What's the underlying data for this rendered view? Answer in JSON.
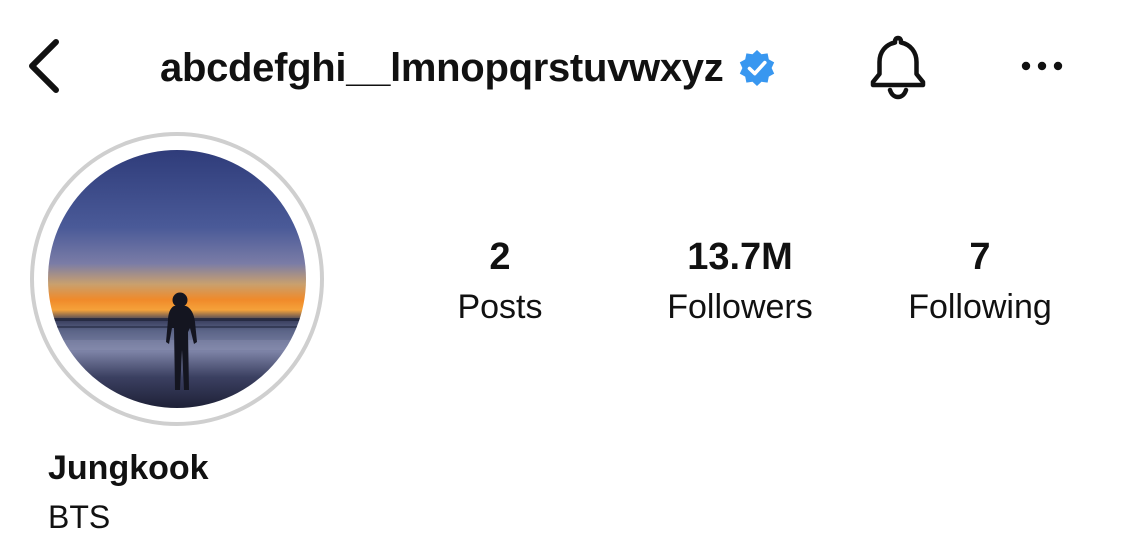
{
  "header": {
    "username": "abcdefghi__lmnopqrstuvwxyz",
    "verified": true,
    "icons": {
      "back": "chevron-left-icon",
      "verified": "verified-badge-icon",
      "notifications": "bell-icon",
      "more": "more-horizontal-icon"
    },
    "verified_color": "#3897f0"
  },
  "profile": {
    "avatar": "avatar",
    "display_name": "Jungkook",
    "bio": "BTS"
  },
  "stats": {
    "posts": {
      "value": "2",
      "label": "Posts"
    },
    "followers": {
      "value": "13.7M",
      "label": "Followers"
    },
    "following": {
      "value": "7",
      "label": "Following"
    }
  }
}
